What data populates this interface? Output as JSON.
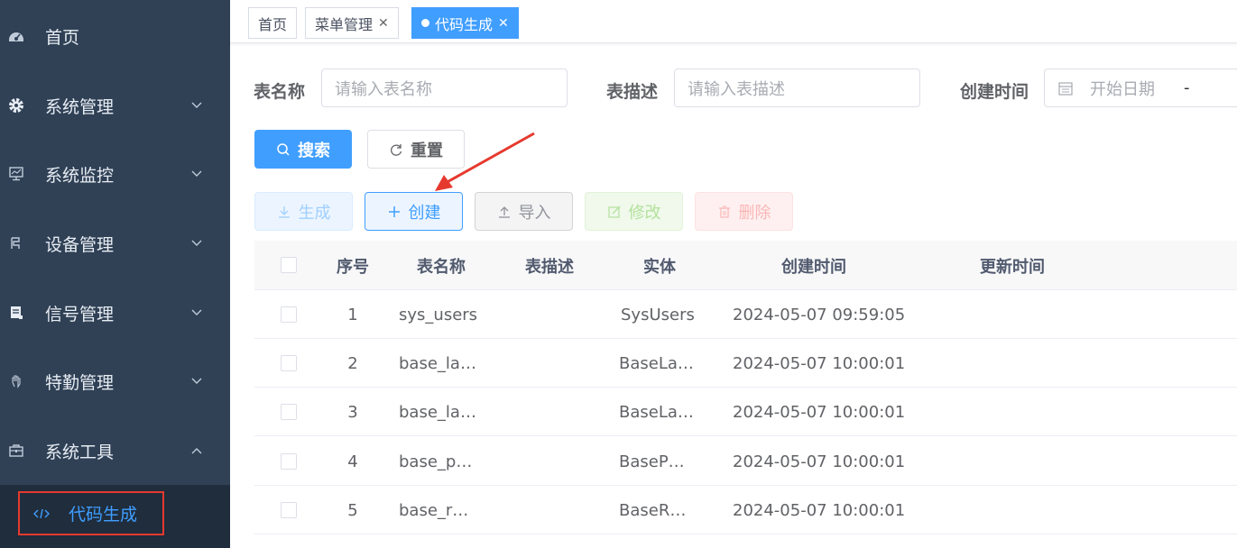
{
  "sidebar": {
    "items": [
      {
        "label": "首页",
        "icon": "dashboard-icon",
        "expandable": false
      },
      {
        "label": "系统管理",
        "icon": "gear-icon",
        "expandable": true,
        "expanded": false
      },
      {
        "label": "系统监控",
        "icon": "monitor-icon",
        "expandable": true,
        "expanded": false
      },
      {
        "label": "设备管理",
        "icon": "device-icon",
        "expandable": true,
        "expanded": false
      },
      {
        "label": "信号管理",
        "icon": "server-icon",
        "expandable": true,
        "expanded": false
      },
      {
        "label": "特勤管理",
        "icon": "hand-icon",
        "expandable": true,
        "expanded": false
      },
      {
        "label": "系统工具",
        "icon": "toolbox-icon",
        "expandable": true,
        "expanded": true
      }
    ],
    "active_sub": {
      "label": "代码生成",
      "icon": "code-icon"
    }
  },
  "tabs": [
    {
      "label": "首页",
      "closable": false,
      "active": false
    },
    {
      "label": "菜单管理",
      "closable": true,
      "active": false
    },
    {
      "label": "代码生成",
      "closable": true,
      "active": true
    }
  ],
  "search": {
    "table_name_label": "表名称",
    "table_name_placeholder": "请输入表名称",
    "table_desc_label": "表描述",
    "table_desc_placeholder": "请输入表描述",
    "created_label": "创建时间",
    "start_date_placeholder": "开始日期",
    "range_sep": "-",
    "search_btn": "搜索",
    "reset_btn": "重置"
  },
  "toolbar": {
    "generate": "生成",
    "create": "创建",
    "import": "导入",
    "edit": "修改",
    "delete": "删除"
  },
  "table": {
    "headers": [
      "序号",
      "表名称",
      "表描述",
      "实体",
      "创建时间",
      "更新时间"
    ],
    "rows": [
      {
        "idx": "1",
        "name": "sys_users",
        "desc": "",
        "entity": "SysUsers",
        "created": "2024-05-07 09:59:05",
        "updated": ""
      },
      {
        "idx": "2",
        "name": "base_la…",
        "desc": "",
        "entity": "BaseLa…",
        "created": "2024-05-07 10:00:01",
        "updated": ""
      },
      {
        "idx": "3",
        "name": "base_la…",
        "desc": "",
        "entity": "BaseLa…",
        "created": "2024-05-07 10:00:01",
        "updated": ""
      },
      {
        "idx": "4",
        "name": "base_p…",
        "desc": "",
        "entity": "BaseP…",
        "created": "2024-05-07 10:00:01",
        "updated": ""
      },
      {
        "idx": "5",
        "name": "base_r…",
        "desc": "",
        "entity": "BaseR…",
        "created": "2024-05-07 10:00:01",
        "updated": ""
      }
    ]
  },
  "colors": {
    "sidebar_bg": "#304156",
    "primary": "#409eff",
    "highlight_border": "#e6392e",
    "arrow": "#e6392e"
  }
}
